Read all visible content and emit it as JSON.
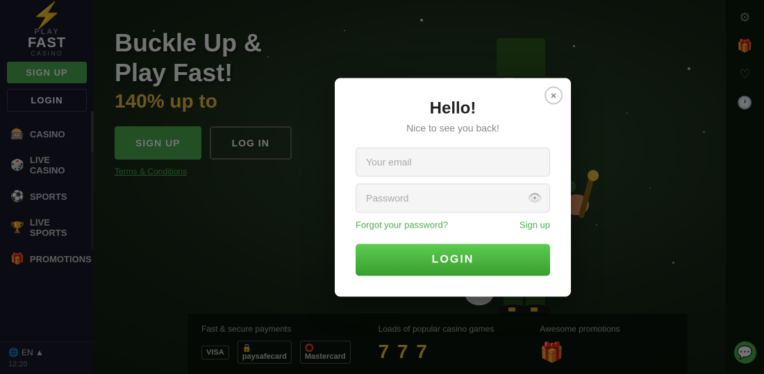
{
  "brand": {
    "play": "PLAY",
    "fast": "FAST",
    "casino": "CASINO",
    "bolt": "⚡"
  },
  "sidebar": {
    "signup_label": "SIGN UP",
    "login_label": "LOGIN",
    "nav_items": [
      {
        "id": "casino",
        "label": "CASINO",
        "icon": "🎰"
      },
      {
        "id": "live-casino",
        "label": "LIVE CASINO",
        "icon": "🎲"
      },
      {
        "id": "sports",
        "label": "SPORTS",
        "icon": "⚽"
      },
      {
        "id": "live-sports",
        "label": "LIVE SPORTS",
        "icon": "🏆"
      },
      {
        "id": "promotions",
        "label": "PROMOTIONS",
        "icon": "🎁"
      }
    ],
    "language": "EN ▲",
    "time": "12:20"
  },
  "hero": {
    "title": "Buckle Up &",
    "title2": "Play Fast!",
    "subtitle": "140% up to",
    "signup_label": "SIGN UP",
    "login_label": "LOG IN",
    "terms_label": "Terms & Conditions"
  },
  "info_bar": {
    "payments_title": "Fast & secure payments",
    "games_title": "Loads of popular casino games",
    "promotions_title": "Awesome promotions",
    "payment_methods": [
      "VISA",
      "paysafecard",
      "Mastercard"
    ]
  },
  "right_sidebar": {
    "icons": [
      "settings",
      "gift",
      "heart",
      "history",
      "chat"
    ]
  },
  "modal": {
    "title": "Hello!",
    "subtitle": "Nice to see you back!",
    "email_placeholder": "Your email",
    "password_placeholder": "Password",
    "forgot_password": "Forgot your password?",
    "sign_up_link": "Sign up",
    "login_button": "LOGIN",
    "close_label": "×"
  }
}
